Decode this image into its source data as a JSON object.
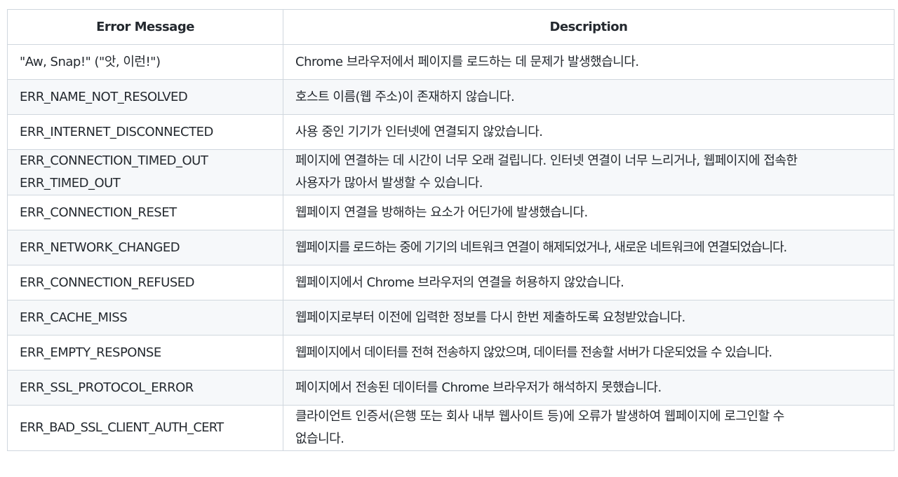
{
  "table": {
    "headers": [
      "Error Message",
      "Description"
    ],
    "rows": [
      {
        "codes": [
          "\"Aw, Snap!\" (\"앗, 이런!\")"
        ],
        "desc": [
          "Chrome 브라우저에서 페이지를 로드하는 데 문제가 발생했습니다."
        ]
      },
      {
        "codes": [
          "ERR_NAME_NOT_RESOLVED"
        ],
        "desc": [
          "호스트 이름(웹 주소)이 존재하지 않습니다."
        ]
      },
      {
        "codes": [
          "ERR_INTERNET_DISCONNECTED"
        ],
        "desc": [
          "사용 중인 기기가 인터넷에 연결되지 않았습니다."
        ]
      },
      {
        "codes": [
          "ERR_CONNECTION_TIMED_OUT",
          "ERR_TIMED_OUT"
        ],
        "desc": [
          "페이지에 연결하는 데 시간이 너무 오래 걸립니다. 인터넷 연결이 너무 느리거나, 웹페이지에 접속한",
          "사용자가 많아서 발생할 수 있습니다."
        ]
      },
      {
        "codes": [
          "ERR_CONNECTION_RESET"
        ],
        "desc": [
          "웹페이지 연결을 방해하는 요소가 어딘가에 발생했습니다."
        ]
      },
      {
        "codes": [
          "ERR_NETWORK_CHANGED"
        ],
        "desc": [
          "웹페이지를 로드하는 중에 기기의 네트워크 연결이 해제되었거나, 새로운 네트워크에 연결되었습니다."
        ]
      },
      {
        "codes": [
          "ERR_CONNECTION_REFUSED"
        ],
        "desc": [
          "웹페이지에서 Chrome 브라우저의 연결을 허용하지 않았습니다."
        ]
      },
      {
        "codes": [
          "ERR_CACHE_MISS"
        ],
        "desc": [
          "웹페이지로부터 이전에 입력한 정보를 다시 한번 제출하도록 요청받았습니다."
        ]
      },
      {
        "codes": [
          "ERR_EMPTY_RESPONSE"
        ],
        "desc": [
          "웹페이지에서 데이터를 전혀 전송하지 않았으며, 데이터를 전송할 서버가 다운되었을 수 있습니다."
        ]
      },
      {
        "codes": [
          "ERR_SSL_PROTOCOL_ERROR"
        ],
        "desc": [
          "페이지에서 전송된 데이터를 Chrome 브라우저가 해석하지 못했습니다."
        ]
      },
      {
        "codes": [
          "ERR_BAD_SSL_CLIENT_AUTH_CERT"
        ],
        "desc": [
          "클라이언트 인증서(은행 또는 회사 내부 웹사이트 등)에 오류가 발생하여 웹페이지에 로그인할 수",
          "없습니다."
        ]
      }
    ]
  }
}
